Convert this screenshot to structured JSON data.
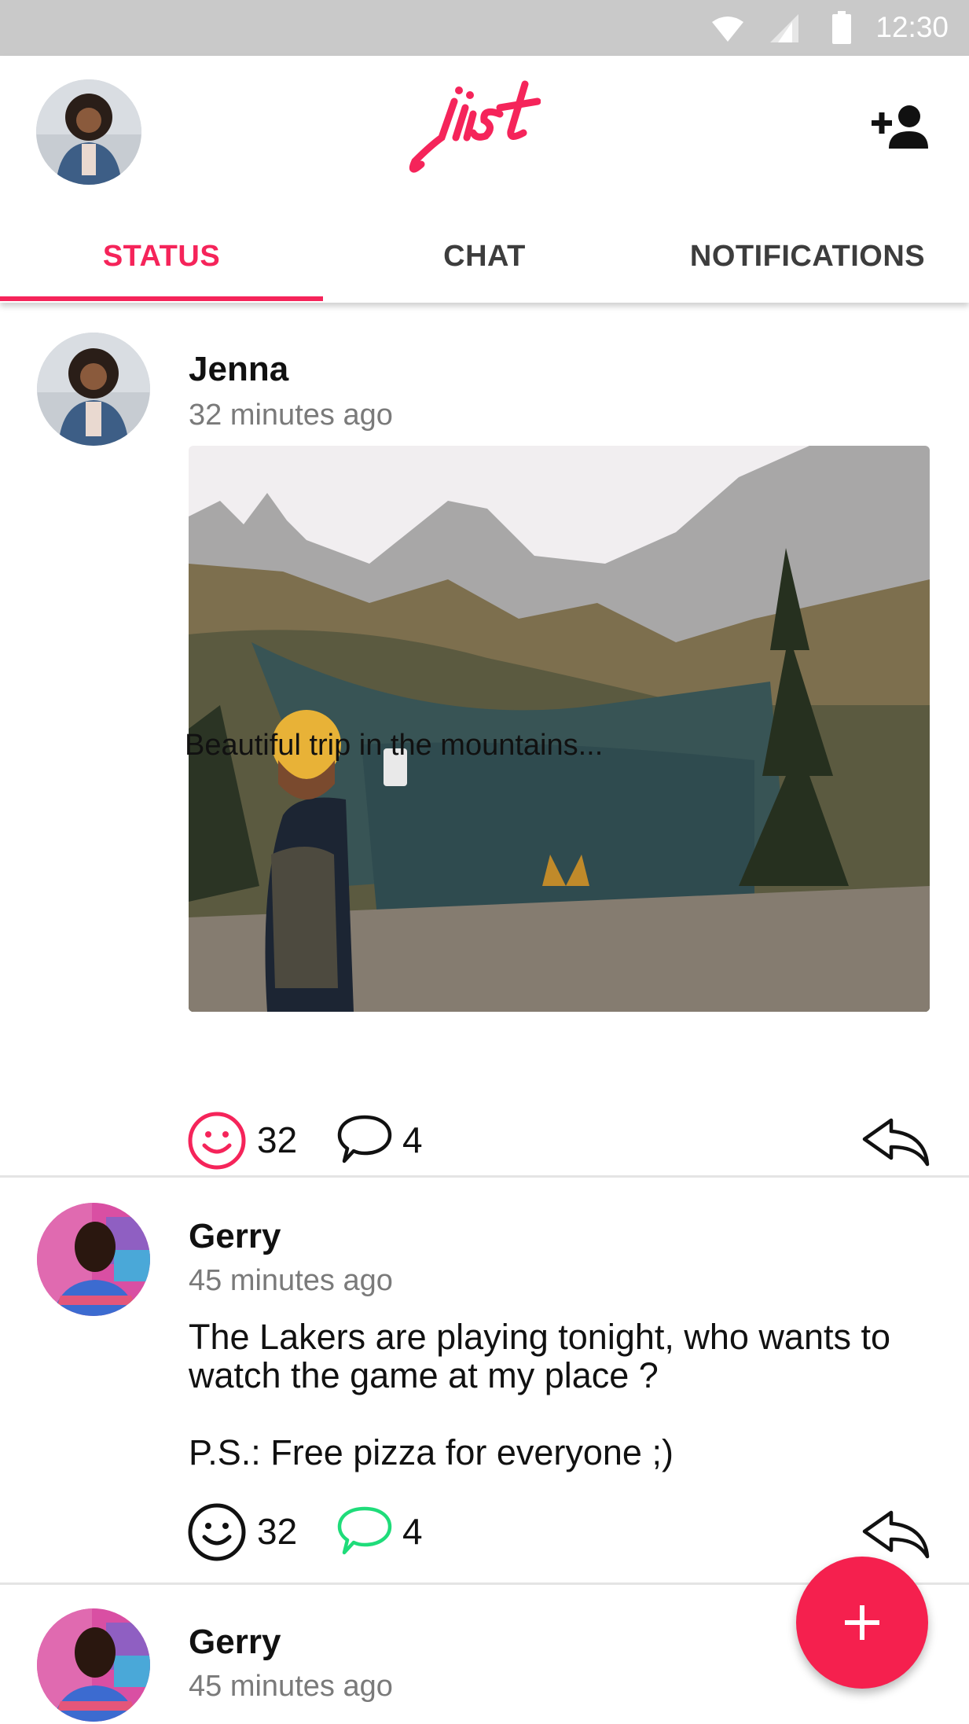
{
  "status_bar": {
    "time": "12:30",
    "icons": [
      "wifi-icon",
      "signal-icon",
      "battery-icon"
    ]
  },
  "header": {
    "logo_text": "jist",
    "add_friend_icon": "add-person-icon"
  },
  "tabs": [
    {
      "label": "STATUS",
      "active": true
    },
    {
      "label": "CHAT",
      "active": false
    },
    {
      "label": "NOTIFICATIONS",
      "active": false
    }
  ],
  "posts": [
    {
      "author": "Jenna",
      "time": "32 minutes ago",
      "caption": "Beautiful trip in the mountains...",
      "likes": "32",
      "comments": "4",
      "photo": "mountain-lake-photo"
    },
    {
      "author": "Gerry",
      "time": "45 minutes ago",
      "text": "The Lakers are playing tonight, who wants to watch the game at my place ?\n\nP.S.: Free pizza for everyone ;)",
      "likes": "32",
      "comments": "4"
    },
    {
      "author": "Gerry",
      "time": "45 minutes ago"
    }
  ],
  "colors": {
    "accent": "#f5245a",
    "comment_active": "#1fdc7a",
    "status_bar": "#c9c9c9"
  },
  "fab": {
    "icon": "plus-icon"
  }
}
